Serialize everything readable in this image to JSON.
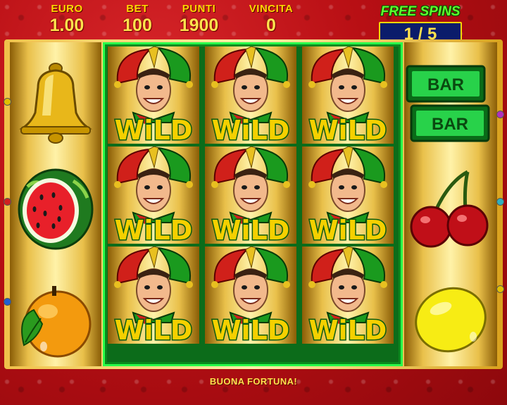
{
  "hud": {
    "euro_label": "EURO",
    "euro_value": "1.00",
    "bet_label": "BET",
    "bet_value": "100",
    "punti_label": "PUNTI",
    "punti_value": "1900",
    "vincita_label": "VINCITA",
    "vincita_value": "0"
  },
  "free_spins": {
    "label": "FREE SPINS",
    "counter": "1 / 5"
  },
  "wild_text": "WiLD",
  "bar_text": "BAR",
  "footer_message": "BUONA FORTUNA!",
  "reels": {
    "reel_1": [
      "bell-icon",
      "watermelon-icon",
      "orange-icon"
    ],
    "reels_2_to_4": "wild-joker-icon",
    "reel_5": [
      "bar-bar-icon",
      "cherries-icon",
      "lemon-icon"
    ]
  },
  "colors": {
    "accent_gold": "#ffe14d",
    "free_spins_green": "#5eff2e",
    "wild_frame_green": "#28ff4a",
    "background_red": "#b80f14"
  }
}
